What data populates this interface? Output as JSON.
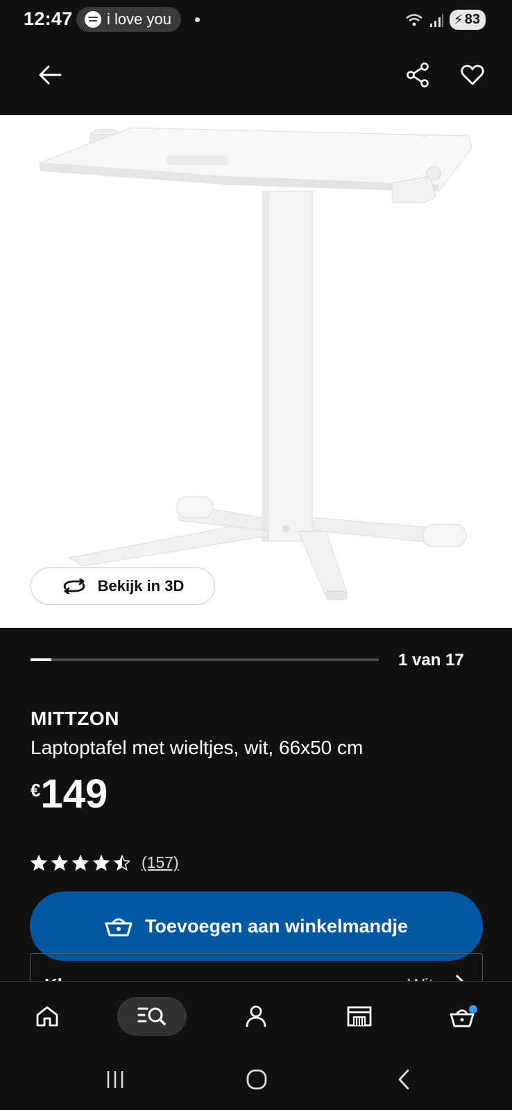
{
  "status_bar": {
    "time": "12:47",
    "media_pill_text": "i love you",
    "battery": "83"
  },
  "header": {
    "back_icon": "arrow-left-icon",
    "share_icon": "share-icon",
    "favorite_icon": "heart-icon"
  },
  "hero": {
    "view_3d_label": "Bekijk in 3D",
    "view_3d_icon": "rotate-3d-icon"
  },
  "gallery": {
    "position_text": "1 van 17",
    "current": 1,
    "total": 17
  },
  "product": {
    "brand": "MITTZON",
    "description": "Laptoptafel met wieltjes, wit, 66x50 cm",
    "currency": "€",
    "price": "149",
    "rating": 4.5,
    "rating_max": 5,
    "review_count": "(157)"
  },
  "actions": {
    "add_to_cart_label": "Toevoegen aan winkelmandje",
    "add_to_cart_icon": "basket-icon"
  },
  "options": {
    "color_label": "Kleur",
    "color_value": "Wit"
  },
  "tabbar": {
    "items": [
      "home-icon",
      "search-list-icon",
      "profile-icon",
      "store-icon",
      "cart-icon"
    ],
    "accent": "#0058a3",
    "badge_color": "#3d9ae8"
  },
  "colors": {
    "background": "#111111",
    "primary_button": "#0058a3",
    "text": "#ffffff"
  }
}
